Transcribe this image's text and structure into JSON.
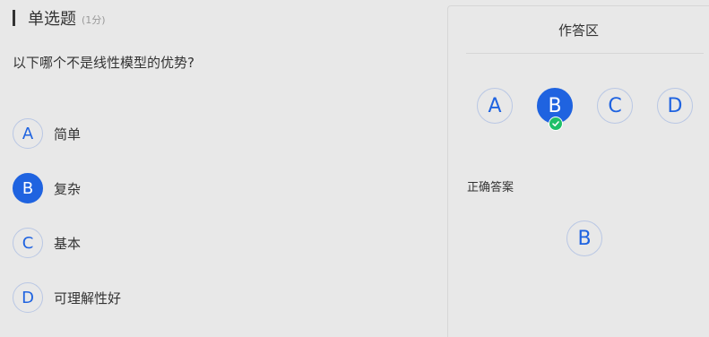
{
  "question": {
    "type_label": "单选题",
    "score_label": "(1分)",
    "text": "以下哪个不是线性模型的优势?",
    "options": [
      {
        "letter": "A",
        "label": "简单",
        "selected": false
      },
      {
        "letter": "B",
        "label": "复杂",
        "selected": true
      },
      {
        "letter": "C",
        "label": "基本",
        "selected": false
      },
      {
        "letter": "D",
        "label": "可理解性好",
        "selected": false
      }
    ]
  },
  "answer_panel": {
    "title": "作答区",
    "choices": [
      "A",
      "B",
      "C",
      "D"
    ],
    "selected_choice": "B",
    "correct_label": "正确答案",
    "correct_answer": "B"
  },
  "colors": {
    "accent": "#1f63e0",
    "success": "#1fbf68",
    "background": "#e8e8e8"
  }
}
